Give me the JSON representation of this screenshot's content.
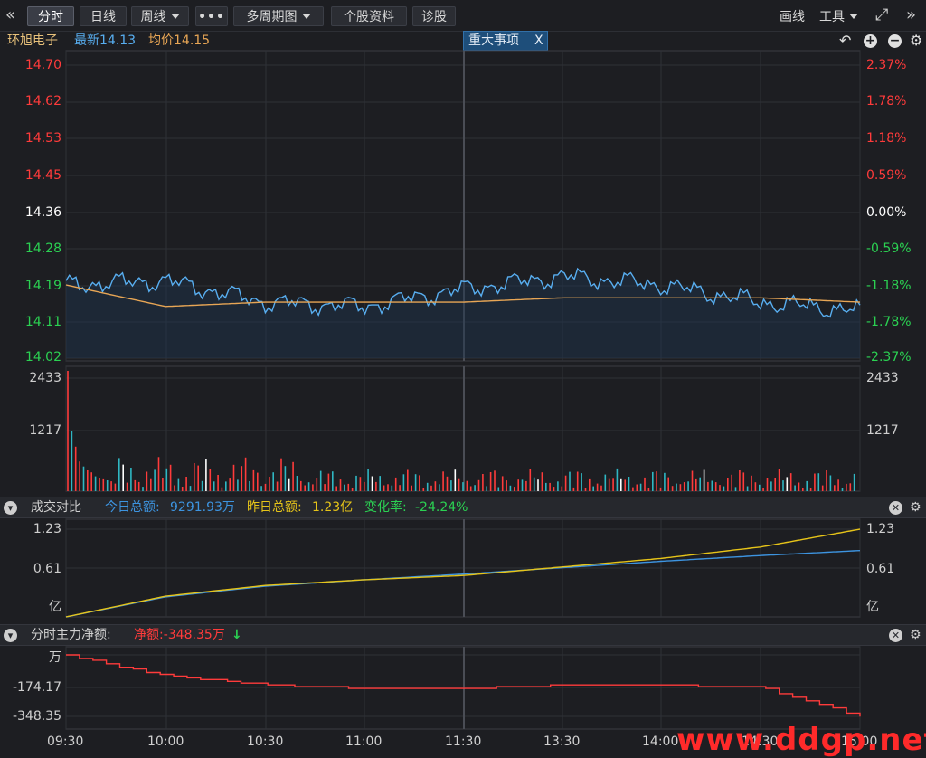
{
  "toolbar": {
    "back_icon": "«",
    "tabs": [
      {
        "label": "分时",
        "active": true
      },
      {
        "label": "日线"
      },
      {
        "label": "周线"
      },
      {
        "label": "•••"
      },
      {
        "label": "多周期图"
      },
      {
        "label": "个股资料"
      },
      {
        "label": "诊股"
      }
    ],
    "draw_label": "画线",
    "tools_label": "工具",
    "fullscreen_icon": "⤢",
    "forward_icon": "»"
  },
  "stock": {
    "name": "环旭电子",
    "latest": "最新14.13",
    "avg": "均价14.15",
    "event_tag": "重大事项",
    "event_close": "X",
    "colors": {
      "price": "#58aef0",
      "avg": "#e8a655",
      "up": "#ff3b3b",
      "down": "#2bd152"
    }
  },
  "price_axis": {
    "left": [
      "14.70",
      "14.62",
      "14.53",
      "14.45",
      "14.36",
      "14.28",
      "14.19",
      "14.11",
      "14.02"
    ],
    "right": [
      "2.37%",
      "1.78%",
      "1.18%",
      "0.59%",
      "0.00%",
      "-0.59%",
      "-1.18%",
      "-1.78%",
      "-2.37%"
    ]
  },
  "volume_axis": {
    "top": "2433",
    "mid": "1217"
  },
  "compare_panel": {
    "title": "成交对比",
    "today_label": "今日总额:",
    "today_value": "9291.93万",
    "yesterday_label": "昨日总额:",
    "yesterday_value": "1.23亿",
    "change_label": "变化率:",
    "change_value": "-24.24%",
    "axis": [
      "1.23",
      "0.61",
      "亿"
    ],
    "colors": {
      "today": "#3d94e0",
      "yesterday": "#e6c419"
    }
  },
  "flow_panel": {
    "title": "分时主力净额:",
    "value": "净额:-348.35万",
    "arrow": "↓",
    "axis": [
      "万",
      "-174.17",
      "-348.35"
    ],
    "color": "#ff3b3b"
  },
  "time_axis": [
    "09:30",
    "10:00",
    "10:30",
    "11:00",
    "11:30",
    "13:30",
    "14:00",
    "14:30",
    "15:00"
  ],
  "watermark": "www.ddgp.net",
  "chart_data": [
    {
      "type": "line",
      "title": "",
      "x": [
        "09:30",
        "10:00",
        "10:30",
        "11:00",
        "11:30/13:00",
        "13:30",
        "14:00",
        "14:30",
        "15:00"
      ],
      "series": [
        {
          "name": "最新",
          "values": [
            14.19,
            14.2,
            14.15,
            14.14,
            14.18,
            14.21,
            14.19,
            14.15,
            14.13
          ]
        },
        {
          "name": "均价",
          "values": [
            14.19,
            14.14,
            14.15,
            14.15,
            14.15,
            14.16,
            14.16,
            14.16,
            14.15
          ]
        }
      ],
      "ylim": [
        14.02,
        14.7
      ]
    },
    {
      "type": "bar",
      "title": "",
      "ylim": [
        0,
        2433
      ],
      "values": [
        2433,
        1217,
        900,
        600,
        500,
        420,
        380,
        300,
        260,
        240,
        220,
        200
      ]
    },
    {
      "type": "line",
      "title": "成交对比",
      "series": [
        {
          "name": "今日总额",
          "values": [
            0,
            0.28,
            0.43,
            0.52,
            0.6,
            0.69,
            0.78,
            0.86,
            0.93
          ]
        },
        {
          "name": "昨日总额",
          "values": [
            0,
            0.29,
            0.44,
            0.52,
            0.58,
            0.7,
            0.82,
            0.98,
            1.23
          ]
        }
      ],
      "ylim": [
        0,
        1.23
      ]
    },
    {
      "type": "line",
      "title": "分时主力净额",
      "series": [
        {
          "name": "净额",
          "values": [
            0,
            -120,
            -170,
            -190,
            -190,
            -170,
            -170,
            -185,
            -348.35
          ]
        }
      ],
      "ylim": [
        -348.35,
        0
      ]
    }
  ]
}
